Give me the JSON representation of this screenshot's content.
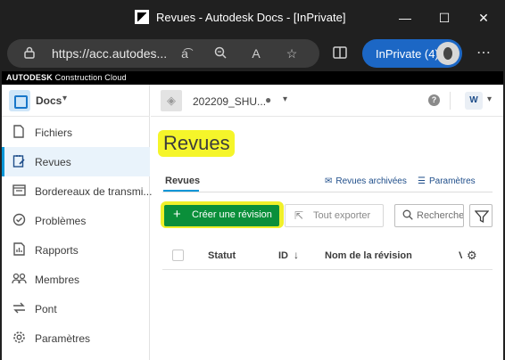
{
  "browser": {
    "tab_title": "Revues - Autodesk Docs - [InPrivate]",
    "url": "https://acc.autodes...",
    "inprivate_label": "InPrivate (4)",
    "controls": {
      "minimize": "—",
      "maximize": "☐",
      "close": "✕",
      "more": "⋯"
    }
  },
  "autodesk_bar": {
    "brand_bold": "AUTODESK",
    "brand_rest": "Construction Cloud"
  },
  "sidebar": {
    "app_name": "Docs",
    "items": [
      {
        "label": "Fichiers",
        "icon": "file-icon"
      },
      {
        "label": "Revues",
        "icon": "review-icon",
        "active": true
      },
      {
        "label": "Bordereaux de transmi...",
        "icon": "transmittal-icon"
      },
      {
        "label": "Problèmes",
        "icon": "issues-icon"
      },
      {
        "label": "Rapports",
        "icon": "reports-icon"
      },
      {
        "label": "Membres",
        "icon": "members-icon"
      },
      {
        "label": "Pont",
        "icon": "bridge-icon"
      },
      {
        "label": "Paramètres",
        "icon": "settings-icon"
      }
    ]
  },
  "topbar": {
    "project_name": "202209_SHU...",
    "help": "?"
  },
  "main": {
    "title": "Revues",
    "tab": "Revues",
    "archived_link": "Revues archivées",
    "settings_link": "Paramètres",
    "create_button": "Créer une révision",
    "export_button": "Tout exporter",
    "search_placeholder": "Rechercher",
    "columns": {
      "status": "Statut",
      "id": "ID",
      "name": "Nom de la révision",
      "next": "V"
    }
  },
  "colors": {
    "accent": "#0696d7",
    "create_green": "#0a8f3a",
    "highlight": "#f5f52a",
    "inprivate": "#1c67c5"
  }
}
